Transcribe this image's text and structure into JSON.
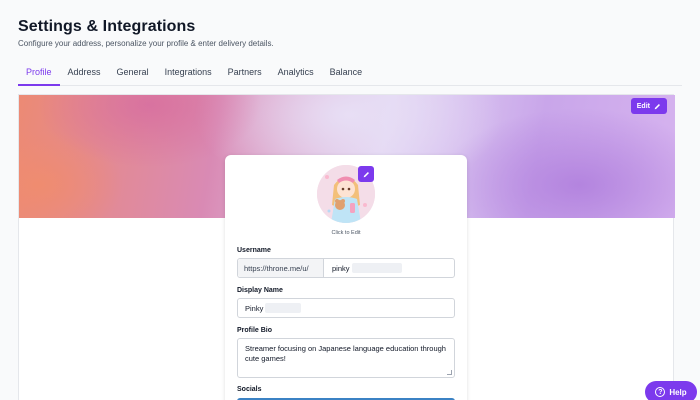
{
  "header": {
    "title": "Settings & Integrations",
    "subtitle": "Configure your address, personalize your profile & enter delivery details."
  },
  "tabs": [
    {
      "label": "Profile",
      "active": true
    },
    {
      "label": "Address"
    },
    {
      "label": "General"
    },
    {
      "label": "Integrations"
    },
    {
      "label": "Partners"
    },
    {
      "label": "Analytics"
    },
    {
      "label": "Balance"
    }
  ],
  "banner": {
    "edit_label": "Edit",
    "edit_icon": "pencil-icon"
  },
  "profile": {
    "click_to_edit": "Click to Edit",
    "username_label": "Username",
    "username_prefix": "https://throne.me/u/",
    "username_value": "pinky",
    "display_name_label": "Display Name",
    "display_name_value": "Pinky",
    "bio_label": "Profile Bio",
    "bio_value": "Streamer focusing on Japanese language education through cute games!",
    "socials_label": "Socials"
  },
  "help": {
    "label": "Help",
    "icon": "question-circle-icon"
  },
  "colors": {
    "accent": "#7c3aed",
    "socials_bar": "#3b82c4"
  }
}
